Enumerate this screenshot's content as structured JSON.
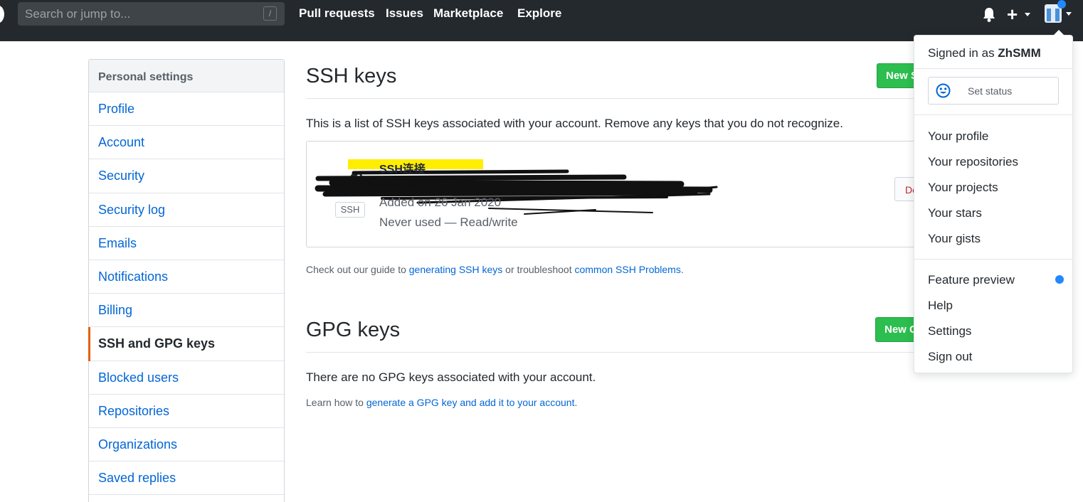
{
  "header": {
    "search_placeholder": "Search or jump to...",
    "search_shortcut": "/",
    "nav": [
      "Pull requests",
      "Issues",
      "Marketplace",
      "Explore"
    ],
    "plus_label": "+",
    "colors": {
      "background": "#24292e",
      "notification_dot": "#2188ff"
    }
  },
  "sidebar": {
    "heading": "Personal settings",
    "items": [
      {
        "label": "Profile"
      },
      {
        "label": "Account"
      },
      {
        "label": "Security"
      },
      {
        "label": "Security log"
      },
      {
        "label": "Emails"
      },
      {
        "label": "Notifications"
      },
      {
        "label": "Billing"
      },
      {
        "label": "SSH and GPG keys",
        "selected": true
      },
      {
        "label": "Blocked users"
      },
      {
        "label": "Repositories"
      },
      {
        "label": "Organizations"
      },
      {
        "label": "Saved replies"
      }
    ]
  },
  "ssh": {
    "title": "SSH keys",
    "new_button": "New SSH key",
    "description": "This is a list of SSH keys associated with your account. Remove any keys that you do not recognize.",
    "key": {
      "title": "SSH连接",
      "type_label": "SSH",
      "added": "Added on 26 Jan 2020",
      "usage": "Never used — Read/write",
      "delete_label": "Delete"
    },
    "help_prefix": "Check out our guide to ",
    "help_link1": "generating SSH keys",
    "help_middle": " or troubleshoot ",
    "help_link2": "common SSH Problems",
    "help_suffix": "."
  },
  "gpg": {
    "title": "GPG keys",
    "new_button": "New GPG key",
    "empty": "There are no GPG keys associated with your account.",
    "help_prefix": "Learn how to ",
    "help_link": "generate a GPG key and add it to your account",
    "help_suffix": "."
  },
  "dropdown": {
    "signed_in_prefix": "Signed in as ",
    "username": "ZhSMM",
    "set_status": "Set status",
    "group1": [
      "Your profile",
      "Your repositories",
      "Your projects",
      "Your stars",
      "Your gists"
    ],
    "group2": [
      "Feature preview",
      "Help",
      "Settings",
      "Sign out"
    ]
  }
}
